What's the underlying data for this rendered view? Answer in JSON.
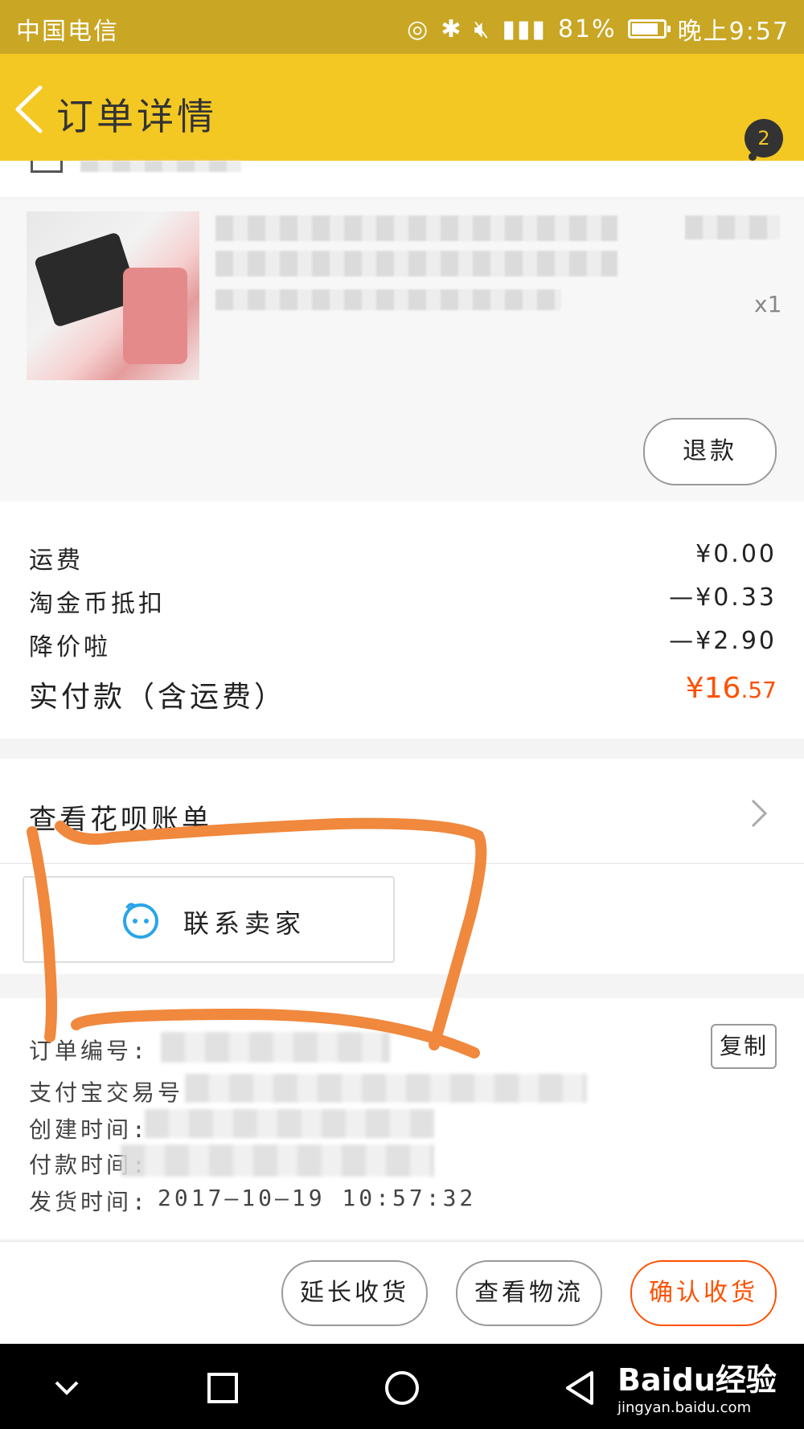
{
  "status_bar": {
    "carrier": "中国电信",
    "battery": "81%",
    "time": "晚上9:57"
  },
  "nav": {
    "title": "订单详情",
    "badge": "2"
  },
  "product": {
    "qty": "x1",
    "refund_label": "退款"
  },
  "fees": [
    {
      "label": "运费",
      "value": "¥0.00"
    },
    {
      "label": "淘金币抵扣",
      "value": "—¥0.33"
    },
    {
      "label": "降价啦",
      "value": "—¥2.90"
    }
  ],
  "total": {
    "label": "实付款（含运费）",
    "currency": "¥",
    "int": "16",
    "dec": ".57"
  },
  "huabei": {
    "label": "查看花呗账单"
  },
  "contact": {
    "label": "联系卖家"
  },
  "order_info": {
    "order_no_label": "订单编号:",
    "copy_label": "复制",
    "alipay_label": "支付宝交易号",
    "created_label": "创建时间:",
    "paid_label": "付款时间:",
    "shipped_label": "发货时间:",
    "shipped_value": "2017—10—19 10:57:32"
  },
  "actions": {
    "extend": "延长收货",
    "logistics": "查看物流",
    "confirm": "确认收货"
  },
  "watermark": {
    "brand": "Baidu经验",
    "url": "jingyan.baidu.com"
  },
  "colors": {
    "status_bar": "#c9a623",
    "nav_bar": "#f4c823",
    "accent": "#ff5000",
    "annotation": "#f0883d"
  }
}
